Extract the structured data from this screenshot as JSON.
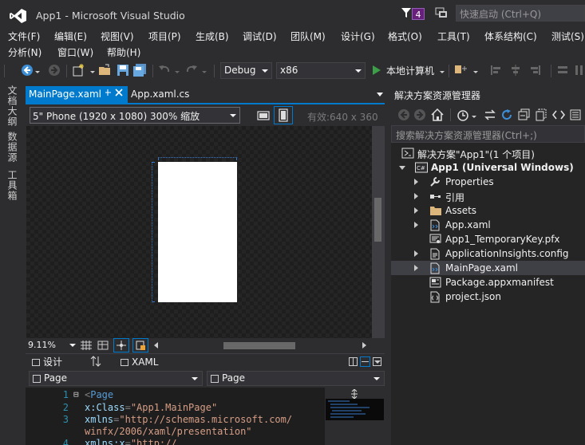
{
  "window": {
    "title": "App1 - Microsoft Visual Studio",
    "notification_count": "4",
    "quick_launch_placeholder": "快速启动 (Ctrl+Q)"
  },
  "menu": {
    "row1": [
      "文件(F)",
      "编辑(E)",
      "视图(V)",
      "项目(P)",
      "生成(B)",
      "调试(D)",
      "团队(M)",
      "设计(G)",
      "格式(O)",
      "工具(T)",
      "体系结构(C)",
      "测试(S)"
    ],
    "row2": [
      "分析(N)",
      "窗口(W)",
      "帮助(H)"
    ]
  },
  "toolbar": {
    "configuration": "Debug",
    "platform": "x86",
    "run_target": "本地计算机"
  },
  "side_tabs": [
    "文档大纲",
    "数据源",
    "工具箱"
  ],
  "editor": {
    "tabs": [
      {
        "label": "MainPage.xaml",
        "active": true
      },
      {
        "label": "App.xaml.cs",
        "active": false
      }
    ],
    "device": "5\" Phone (1920 x 1080) 300% 缩放",
    "effective_size": "有效:640 x 360",
    "zoom": "9.11%",
    "design_tab": "设计",
    "xaml_tab": "XAML",
    "nav_left": "Page",
    "nav_right": "Page",
    "code_lines": [
      {
        "num": "1",
        "fold": "⊟",
        "parts": [
          [
            "c-pun",
            "<"
          ],
          [
            "c-tag",
            "Page"
          ]
        ]
      },
      {
        "num": "2",
        "fold": "",
        "parts": [
          [
            "c-attr",
            "    x:Class"
          ],
          [
            "c-pun",
            "="
          ],
          [
            "c-str",
            "\"App1.MainPage\""
          ]
        ]
      },
      {
        "num": "3",
        "fold": "",
        "parts": [
          [
            "c-attr",
            "    xmlns"
          ],
          [
            "c-pun",
            "="
          ],
          [
            "c-str",
            "\"http://schemas.microsoft.com/"
          ]
        ]
      },
      {
        "num": "",
        "fold": "",
        "parts": [
          [
            "c-str",
            "      winfx/2006/xaml/presentation\""
          ]
        ]
      },
      {
        "num": "4",
        "fold": "",
        "parts": [
          [
            "c-attr",
            "    xmlns:x"
          ],
          [
            "c-pun",
            "="
          ],
          [
            "c-str",
            "\"http://"
          ]
        ]
      }
    ]
  },
  "solution_explorer": {
    "title": "解决方案资源管理器",
    "search_placeholder": "搜索解决方案资源管理器(Ctrl+;)",
    "items": [
      {
        "label": "解决方案\"App1\"(1 个项目)",
        "icon": "solution-icon",
        "level": 0,
        "expander": "none",
        "bold": false,
        "selected": false
      },
      {
        "label": "App1 (Universal Windows)",
        "icon": "csharp-project-icon",
        "level": 1,
        "expander": "open",
        "bold": true,
        "selected": false
      },
      {
        "label": "Properties",
        "icon": "wrench-icon",
        "level": 2,
        "expander": "closed",
        "bold": false,
        "selected": false
      },
      {
        "label": "引用",
        "icon": "references-icon",
        "level": 2,
        "expander": "closed",
        "bold": false,
        "selected": false
      },
      {
        "label": "Assets",
        "icon": "folder-icon",
        "level": 2,
        "expander": "closed",
        "bold": false,
        "selected": false
      },
      {
        "label": "App.xaml",
        "icon": "xaml-file-icon",
        "level": 2,
        "expander": "closed",
        "bold": false,
        "selected": false
      },
      {
        "label": "App1_TemporaryKey.pfx",
        "icon": "certificate-icon",
        "level": 2,
        "expander": "none",
        "bold": false,
        "selected": false
      },
      {
        "label": "ApplicationInsights.config",
        "icon": "config-file-icon",
        "level": 2,
        "expander": "closed",
        "bold": false,
        "selected": false
      },
      {
        "label": "MainPage.xaml",
        "icon": "xaml-file-icon",
        "level": 2,
        "expander": "closed",
        "bold": false,
        "selected": true
      },
      {
        "label": "Package.appxmanifest",
        "icon": "manifest-icon",
        "level": 2,
        "expander": "none",
        "bold": false,
        "selected": false
      },
      {
        "label": "project.json",
        "icon": "json-file-icon",
        "level": 2,
        "expander": "none",
        "bold": false,
        "selected": false
      }
    ]
  },
  "colors": {
    "accent": "#007acc",
    "background": "#2d2d30",
    "editor_bg": "#1e1e1e",
    "run_green": "#3c9e46",
    "vs_purple": "#68217a"
  }
}
